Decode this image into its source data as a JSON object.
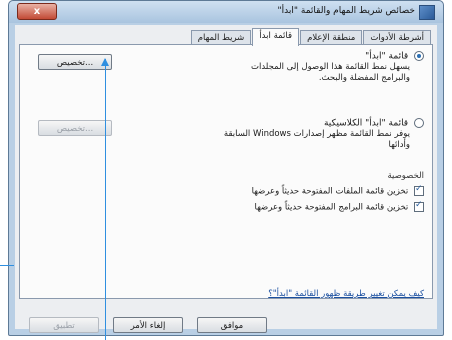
{
  "window": {
    "title": "خصائص شريط المهام والقائمة \"ابدأ\"",
    "close_label": "x"
  },
  "tabs": [
    {
      "label": "شريط المهام"
    },
    {
      "label": "قائمة ابدأ"
    },
    {
      "label": "منطقة الإعلام"
    },
    {
      "label": "أشرطة الأدوات"
    }
  ],
  "start_menu": {
    "option_label": "قائمة \"ابدأ\"",
    "option_desc": "يسهل نمط القائمة هذا الوصول إلى المجلدات والبرامج المفضلة والبحث.",
    "customize_label": "تخصيص...",
    "classic_label": "قائمة \"ابدأ\" الكلاسيكية",
    "classic_desc": "يوفر نمط القائمة مظهر إصدارات Windows السابقة وأدائها",
    "classic_customize_label": "تخصيص..."
  },
  "privacy": {
    "heading": "الخصوصية",
    "store_files": "تخزين قائمة الملفات المفتوحة حديثاً وعرضها",
    "store_programs": "تخزين قائمة البرامج المفتوحة حديثاً وعرضها"
  },
  "help_link": "كيف يمكن تغيير طريقة ظهور القائمة \"ابدأ\"؟",
  "buttons": {
    "ok": "موافق",
    "cancel": "إلغاء الأمر",
    "apply": "تطبيق"
  }
}
